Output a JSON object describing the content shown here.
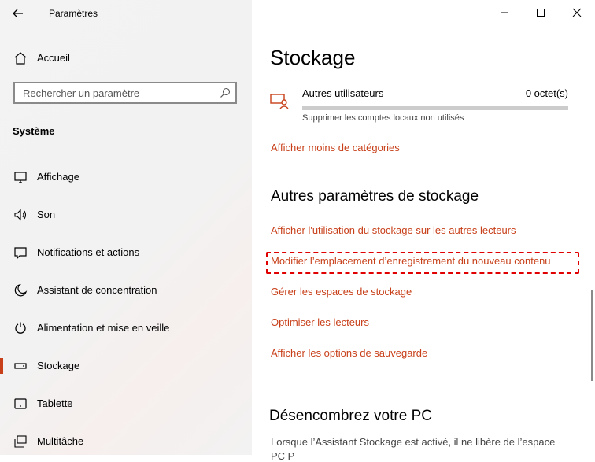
{
  "app": {
    "title": "Paramètres"
  },
  "sidebar": {
    "home_label": "Accueil",
    "search_placeholder": "Rechercher un paramètre",
    "section_title": "Système",
    "items": [
      {
        "label": "Affichage",
        "icon": "display-icon"
      },
      {
        "label": "Son",
        "icon": "speaker-icon"
      },
      {
        "label": "Notifications et actions",
        "icon": "notification-icon"
      },
      {
        "label": "Assistant de concentration",
        "icon": "moon-icon"
      },
      {
        "label": "Alimentation et mise en veille",
        "icon": "power-icon"
      },
      {
        "label": "Stockage",
        "icon": "storage-icon",
        "active": true
      },
      {
        "label": "Tablette",
        "icon": "tablet-icon"
      },
      {
        "label": "Multitâche",
        "icon": "multitask-icon"
      }
    ]
  },
  "main": {
    "title": "Stockage",
    "storage_item": {
      "name": "Autres utilisateurs",
      "size": "0 octet(s)",
      "description": "Supprimer les comptes locaux non utilisés",
      "fill_fraction": 0
    },
    "show_less_link": "Afficher moins de catégories",
    "other_settings_title": "Autres paramètres de stockage",
    "links": [
      "Afficher l'utilisation du stockage sur les autres lecteurs",
      "Modifier l’emplacement d’enregistrement du nouveau contenu",
      "Gérer les espaces de stockage",
      "Optimiser les lecteurs",
      "Afficher les options de sauvegarde"
    ],
    "declutter_title": "Désencombrez votre PC",
    "declutter_text": "Lorsque l’Assistant Stockage est activé, il ne libère de l’espace",
    "declutter_text_2": "                         PC                               P              "
  },
  "colors": {
    "accent": "#c8401a",
    "highlight": "#e00000"
  }
}
